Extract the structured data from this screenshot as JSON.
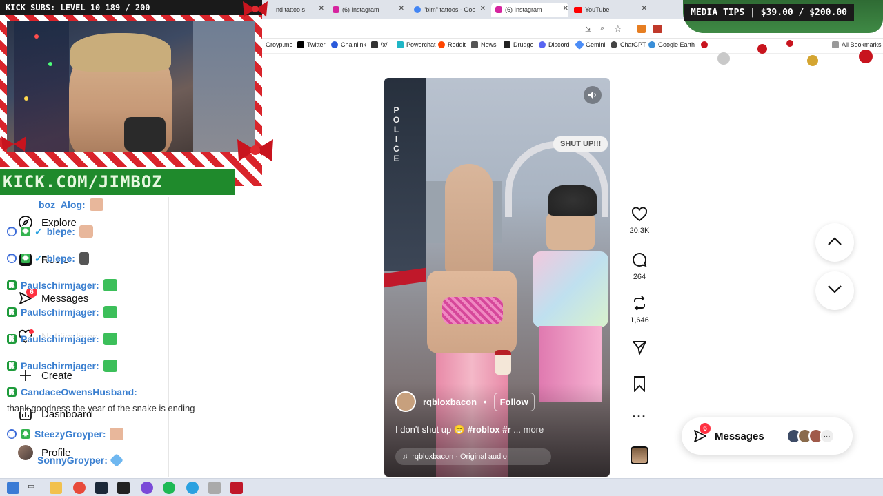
{
  "browser": {
    "tabs": [
      {
        "label": "nd tattoo s",
        "active": false
      },
      {
        "label": "(6) Instagram",
        "active": false
      },
      {
        "label": "\"blm\" tattoos - Goo",
        "active": false
      },
      {
        "label": "(6) Instagram",
        "active": true
      },
      {
        "label": "YouTube",
        "active": false
      }
    ],
    "bookmarks": [
      "Groyp.me",
      "Twitter",
      "Chainlink",
      "/x/",
      "Powerchat",
      "Reddit",
      "News",
      "Drudge",
      "Discord",
      "Gemini",
      "ChatGPT",
      "Google Earth",
      "All Bookmarks"
    ]
  },
  "stream_overlay": {
    "subs_text": "KICK SUBS: LEVEL 10 189 / 200",
    "media_tips": "MEDIA TIPS | $39.00 / $200.00",
    "kick_url": "KICK.COM/JIMBOZ"
  },
  "sidebar": {
    "items": [
      {
        "label": "Explore",
        "icon": "compass-icon"
      },
      {
        "label": "Reels",
        "icon": "reels-icon"
      },
      {
        "label": "Messages",
        "icon": "messenger-icon",
        "badge": "6"
      },
      {
        "label": "Notifications",
        "icon": "heart-icon"
      },
      {
        "label": "Create",
        "icon": "plus-icon"
      },
      {
        "label": "Dashboard",
        "icon": "dashboard-icon"
      },
      {
        "label": "Profile",
        "icon": "avatar"
      }
    ]
  },
  "chat": {
    "lines": [
      {
        "user": "boz_Alog:"
      },
      {
        "user": "blepe:"
      },
      {
        "user": "blepe:"
      },
      {
        "user": "Paulschirmjager:"
      },
      {
        "user": "Paulschirmjager:"
      },
      {
        "user": "Paulschirmjager:"
      },
      {
        "user": "Paulschirmjager:"
      },
      {
        "user": "CandaceOwensHusband:"
      },
      {
        "user": "SteezyGroyper:"
      },
      {
        "user": "SonnyGroyper:"
      }
    ],
    "message": "thank goodness the year of the snake is ending"
  },
  "reel": {
    "scene_text_sign": "SHUT UP!!!",
    "scene_text_police": "POLICE",
    "author": "rqbloxbacon",
    "follow_label": "Follow",
    "caption_text": "I don't shut up 😁 ",
    "caption_tags": "#roblox #r",
    "caption_more": "... more",
    "audio": "rqbloxbacon · Original audio"
  },
  "actions": {
    "likes": "20.3K",
    "comments": "264",
    "reposts": "1,646"
  },
  "messages_pill": {
    "label": "Messages",
    "badge": "6"
  },
  "colors": {
    "instagram_red": "#ff3040",
    "kick_green": "#1e9b3b",
    "chat_blue": "#3a7fd0",
    "candy_red": "#d9242b"
  }
}
